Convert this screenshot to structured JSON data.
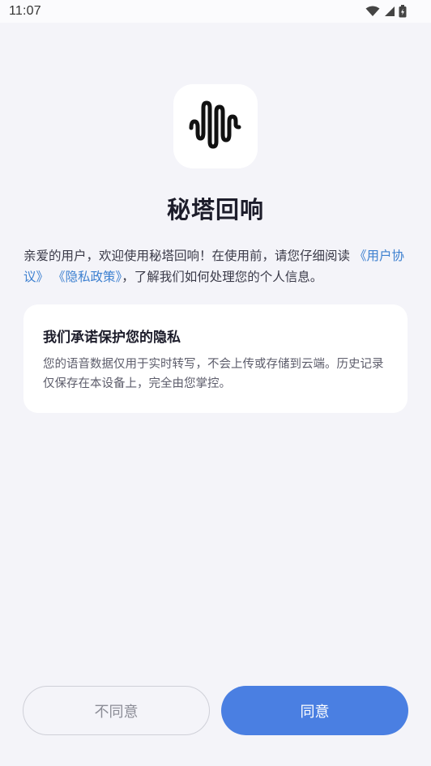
{
  "status_bar": {
    "time": "11:07",
    "icons": [
      "wifi-icon",
      "signal-icon",
      "battery-icon"
    ]
  },
  "app": {
    "icon": "soundwave-logo-icon",
    "title": "秘塔回响"
  },
  "intro": {
    "text_before": "亲爱的用户，欢迎使用秘塔回响！在使用前，请您仔细阅读",
    "user_agreement_link": "《用户协议》",
    "privacy_policy_link": "《隐私政策》",
    "text_after": "，了解我们如何处理您的个人信息。"
  },
  "privacy_card": {
    "title": "我们承诺保护您的隐私",
    "body": "您的语音数据仅用于实时转写，不会上传或存储到云端。历史记录仅保存在本设备上，完全由您掌控。"
  },
  "buttons": {
    "decline_label": "不同意",
    "agree_label": "同意"
  },
  "colors": {
    "background": "#f4f4f9",
    "accent": "#4a7fe2",
    "link": "#3d80d0"
  }
}
